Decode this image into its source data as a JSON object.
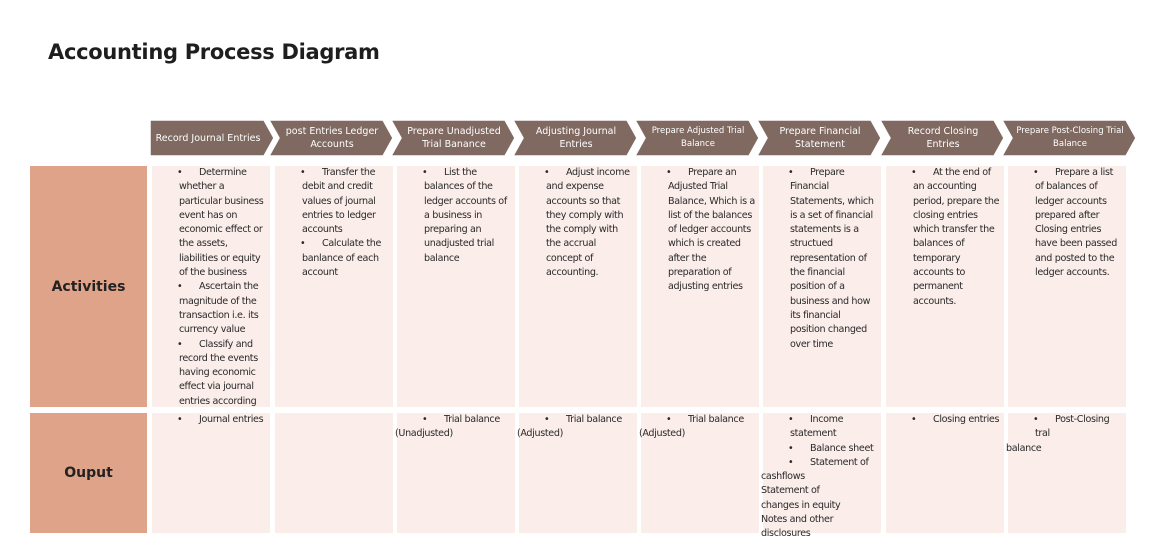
{
  "title": "Accounting Process Diagram",
  "colors": {
    "chevron": "#7f6961",
    "row_label": "#dfa38a",
    "cell": "#faedea"
  },
  "steps": [
    {
      "label": "Record Journal Entries"
    },
    {
      "label": "post Entries Ledger Accounts"
    },
    {
      "label": "Prepare Unadjusted Trial Banance"
    },
    {
      "label": "Adjusting Journal Entries"
    },
    {
      "label": "Prepare Adjusted Trial Balance"
    },
    {
      "label": "Prepare Financial Statement"
    },
    {
      "label": "Record Closing Entries"
    },
    {
      "label": "Prepare Post-Closing Trial Balance"
    }
  ],
  "rows": {
    "activities": "Activities",
    "output": "Ouput"
  },
  "activities": [
    [
      "Determine whether a particular business event has on economic effect or the assets, liabilities or equity of the business",
      "Ascertain the magnitude of the transaction i.e. its currency value",
      "Classify and record the events having economic effect via journal entries according"
    ],
    [
      "Transfer the debit and credit values of journal entries to ledger accounts",
      "Calculate the banlance of each account"
    ],
    [
      "List the balances of the ledger accounts of a business in preparing an unadjusted trial balance"
    ],
    [
      "Adjust income and expense accounts so that they comply with the comply with the accrual concept of accounting."
    ],
    [
      "Prepare an Adjusted Trial Balance, Which is a list of the balances of ledger accounts which is created after the preparation of adjusting entries"
    ],
    [
      "Prepare Financial Statements, which is a set of financial statements is a structued representation of the financial position of a business and how its financial position changed over time"
    ],
    [
      "At the end of an accounting period, prepare the closing entries which transfer the balances of temporary accounts to permanent accounts."
    ],
    [
      "Prepare a list of balances of ledger accounts prepared after Closing entries have been passed and posted to the ledger accounts."
    ]
  ],
  "outputs": [
    {
      "bullets": [
        "Journal entries"
      ],
      "tail": []
    },
    {
      "bullets": [],
      "tail": []
    },
    {
      "bullets": [
        "Trial balance"
      ],
      "tail": [
        "(Unadjusted)"
      ]
    },
    {
      "bullets": [
        "Trial balance"
      ],
      "tail": [
        "(Adjusted)"
      ]
    },
    {
      "bullets": [
        "Trial balance"
      ],
      "tail": [
        "(Adjusted)"
      ]
    },
    {
      "bullets": [
        "Income statement",
        "Balance sheet",
        "Statement of"
      ],
      "tail": [
        "cashflows",
        "Statement of",
        "changes in equity",
        "Notes and other",
        "disclosures"
      ]
    },
    {
      "bullets": [
        "Closing entries"
      ],
      "tail": []
    },
    {
      "bullets": [
        "Post-Closing tral"
      ],
      "tail": [
        "balance"
      ]
    }
  ]
}
